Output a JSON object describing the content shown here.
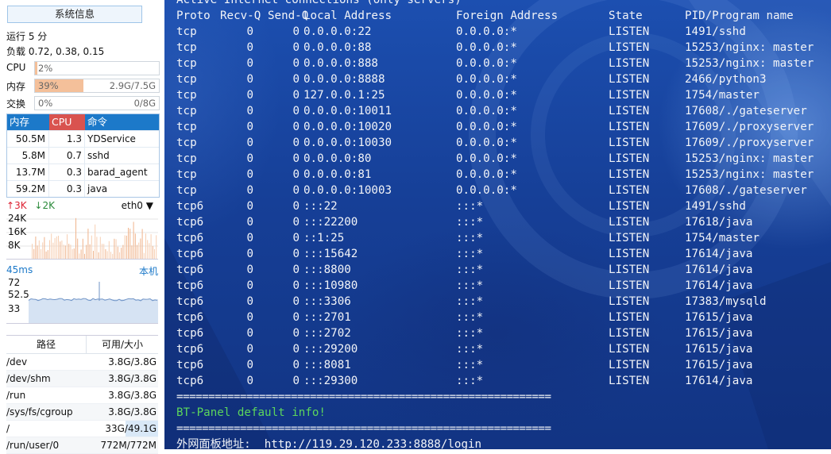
{
  "sidebar": {
    "title_button": "系统信息",
    "uptime": "运行 5 分",
    "load": "负载 0.72, 0.38, 0.15",
    "cpu": {
      "label": "CPU",
      "text": "2%",
      "percent": 2
    },
    "mem": {
      "label": "内存",
      "text": "39%",
      "percent": 39,
      "detail": "2.9G/7.5G"
    },
    "swap": {
      "label": "交换",
      "text": "0%",
      "percent": 0,
      "detail": "0/8G"
    },
    "process_table": {
      "headers": {
        "mem": "内存",
        "cpu": "CPU",
        "cmd": "命令"
      },
      "rows": [
        {
          "mem": "50.5M",
          "cpu": "1.3",
          "cmd": "YDService"
        },
        {
          "mem": "5.8M",
          "cpu": "0.7",
          "cmd": "sshd"
        },
        {
          "mem": "13.7M",
          "cpu": "0.3",
          "cmd": "barad_agent"
        },
        {
          "mem": "59.2M",
          "cpu": "0.3",
          "cmd": "java"
        }
      ]
    },
    "network": {
      "up": "3K",
      "down": "2K",
      "interface": "eth0",
      "ticks": [
        "24K",
        "16K",
        "8K"
      ]
    },
    "latency": {
      "value": "45ms",
      "link": "本机",
      "ticks": [
        "72",
        "52.5",
        "33"
      ]
    },
    "disk_table": {
      "headers": {
        "path": "路径",
        "size": "可用/大小"
      },
      "rows": [
        {
          "path": "/dev",
          "size": "3.8G/3.8G"
        },
        {
          "path": "/dev/shm",
          "size": "3.8G/3.8G"
        },
        {
          "path": "/run",
          "size": "3.8G/3.8G"
        },
        {
          "path": "/sys/fs/cgroup",
          "size": "3.8G/3.8G"
        },
        {
          "path": "/",
          "size": "33G/49.1G"
        },
        {
          "path": "/run/user/0",
          "size": "772M/772M"
        }
      ]
    }
  },
  "terminal": {
    "top_line": "Active Internet connections (only servers)",
    "headers": {
      "proto": "Proto",
      "recvq": "Recv-Q",
      "sendq": "Send-Q",
      "local": "Local Address",
      "foreign": "Foreign Address",
      "state": "State",
      "pid": "PID/Program name"
    },
    "rows": [
      {
        "proto": "tcp",
        "recvq": "0",
        "sendq": "0",
        "local": "0.0.0.0:22",
        "foreign": "0.0.0.0:*",
        "state": "LISTEN",
        "pid": "1491/sshd"
      },
      {
        "proto": "tcp",
        "recvq": "0",
        "sendq": "0",
        "local": "0.0.0.0:88",
        "foreign": "0.0.0.0:*",
        "state": "LISTEN",
        "pid": "15253/nginx: master"
      },
      {
        "proto": "tcp",
        "recvq": "0",
        "sendq": "0",
        "local": "0.0.0.0:888",
        "foreign": "0.0.0.0:*",
        "state": "LISTEN",
        "pid": "15253/nginx: master"
      },
      {
        "proto": "tcp",
        "recvq": "0",
        "sendq": "0",
        "local": "0.0.0.0:8888",
        "foreign": "0.0.0.0:*",
        "state": "LISTEN",
        "pid": "2466/python3"
      },
      {
        "proto": "tcp",
        "recvq": "0",
        "sendq": "0",
        "local": "127.0.0.1:25",
        "foreign": "0.0.0.0:*",
        "state": "LISTEN",
        "pid": "1754/master"
      },
      {
        "proto": "tcp",
        "recvq": "0",
        "sendq": "0",
        "local": "0.0.0.0:10011",
        "foreign": "0.0.0.0:*",
        "state": "LISTEN",
        "pid": "17608/./gateserver"
      },
      {
        "proto": "tcp",
        "recvq": "0",
        "sendq": "0",
        "local": "0.0.0.0:10020",
        "foreign": "0.0.0.0:*",
        "state": "LISTEN",
        "pid": "17609/./proxyserver"
      },
      {
        "proto": "tcp",
        "recvq": "0",
        "sendq": "0",
        "local": "0.0.0.0:10030",
        "foreign": "0.0.0.0:*",
        "state": "LISTEN",
        "pid": "17609/./proxyserver"
      },
      {
        "proto": "tcp",
        "recvq": "0",
        "sendq": "0",
        "local": "0.0.0.0:80",
        "foreign": "0.0.0.0:*",
        "state": "LISTEN",
        "pid": "15253/nginx: master"
      },
      {
        "proto": "tcp",
        "recvq": "0",
        "sendq": "0",
        "local": "0.0.0.0:81",
        "foreign": "0.0.0.0:*",
        "state": "LISTEN",
        "pid": "15253/nginx: master"
      },
      {
        "proto": "tcp",
        "recvq": "0",
        "sendq": "0",
        "local": "0.0.0.0:10003",
        "foreign": "0.0.0.0:*",
        "state": "LISTEN",
        "pid": "17608/./gateserver"
      },
      {
        "proto": "tcp6",
        "recvq": "0",
        "sendq": "0",
        "local": ":::22",
        "foreign": ":::*",
        "state": "LISTEN",
        "pid": "1491/sshd"
      },
      {
        "proto": "tcp6",
        "recvq": "0",
        "sendq": "0",
        "local": ":::22200",
        "foreign": ":::*",
        "state": "LISTEN",
        "pid": "17618/java"
      },
      {
        "proto": "tcp6",
        "recvq": "0",
        "sendq": "0",
        "local": "::1:25",
        "foreign": ":::*",
        "state": "LISTEN",
        "pid": "1754/master"
      },
      {
        "proto": "tcp6",
        "recvq": "0",
        "sendq": "0",
        "local": ":::15642",
        "foreign": ":::*",
        "state": "LISTEN",
        "pid": "17614/java"
      },
      {
        "proto": "tcp6",
        "recvq": "0",
        "sendq": "0",
        "local": ":::8800",
        "foreign": ":::*",
        "state": "LISTEN",
        "pid": "17614/java"
      },
      {
        "proto": "tcp6",
        "recvq": "0",
        "sendq": "0",
        "local": ":::10980",
        "foreign": ":::*",
        "state": "LISTEN",
        "pid": "17614/java"
      },
      {
        "proto": "tcp6",
        "recvq": "0",
        "sendq": "0",
        "local": ":::3306",
        "foreign": ":::*",
        "state": "LISTEN",
        "pid": "17383/mysqld"
      },
      {
        "proto": "tcp6",
        "recvq": "0",
        "sendq": "0",
        "local": ":::2701",
        "foreign": ":::*",
        "state": "LISTEN",
        "pid": "17615/java"
      },
      {
        "proto": "tcp6",
        "recvq": "0",
        "sendq": "0",
        "local": ":::2702",
        "foreign": ":::*",
        "state": "LISTEN",
        "pid": "17615/java"
      },
      {
        "proto": "tcp6",
        "recvq": "0",
        "sendq": "0",
        "local": ":::29200",
        "foreign": ":::*",
        "state": "LISTEN",
        "pid": "17615/java"
      },
      {
        "proto": "tcp6",
        "recvq": "0",
        "sendq": "0",
        "local": ":::8081",
        "foreign": ":::*",
        "state": "LISTEN",
        "pid": "17615/java"
      },
      {
        "proto": "tcp6",
        "recvq": "0",
        "sendq": "0",
        "local": ":::29300",
        "foreign": ":::*",
        "state": "LISTEN",
        "pid": "17614/java"
      }
    ],
    "separator": "===========================================================",
    "info_line": "BT-Panel default info!",
    "login_line": "外网面板地址:  http://119.29.120.233:8888/login"
  },
  "colors": {
    "terminal_bg": "#1c4fb0",
    "accent_blue": "#1c79c9",
    "cpu_red": "#d9534f",
    "mem_fill": "#f4c09a",
    "info_green": "#5cd65c"
  },
  "icons": {
    "network_up": "arrow-up-icon",
    "network_down": "arrow-down-icon",
    "interface_dropdown": "caret-down-icon"
  }
}
